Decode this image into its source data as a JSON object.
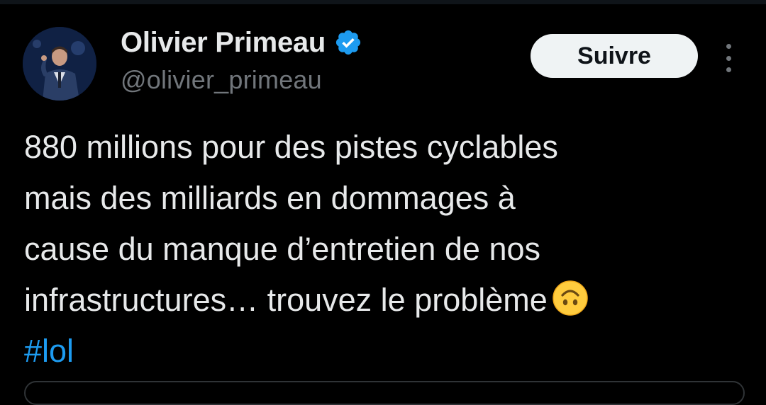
{
  "user": {
    "display_name": "Olivier Primeau",
    "handle": "@olivier_primeau",
    "verified": true
  },
  "actions": {
    "follow_label": "Suivre"
  },
  "tweet": {
    "lines": [
      "880 millions pour des pistes cyclables",
      "mais des milliards en dommages à",
      "cause du manque d’entretien de nos",
      "infrastructures… trouvez le problème"
    ],
    "emoji": "upside-down-face",
    "hashtag": "#lol"
  },
  "icons": {
    "verified": "verified-badge-icon",
    "more": "more-vertical-icon",
    "emoji": "upside-down-face-icon"
  },
  "colors": {
    "background": "#000000",
    "text_primary": "#e7e9ea",
    "text_secondary": "#71767b",
    "accent": "#1d9bf0",
    "button_bg": "#eff3f4",
    "button_text": "#0f1419",
    "border": "#2f3336"
  }
}
